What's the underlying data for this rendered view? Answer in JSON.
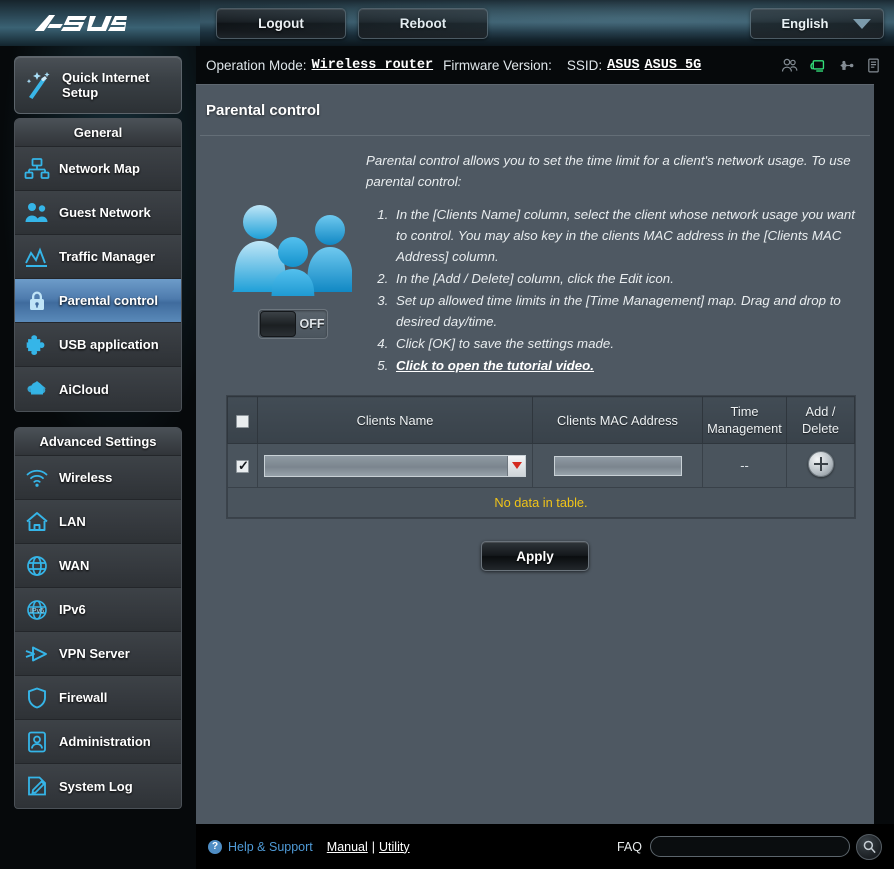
{
  "brand": {
    "logo_text": "/ISUS"
  },
  "topbar": {
    "logout_label": "Logout",
    "reboot_label": "Reboot",
    "language": "English"
  },
  "infobar": {
    "operation_mode_label": "Operation Mode:",
    "operation_mode_value": "Wireless router",
    "firmware_label": "Firmware Version:",
    "firmware_value": "",
    "ssid_label": "SSID:",
    "ssid_value_1": "ASUS",
    "ssid_value_2": "ASUS_5G",
    "icons": [
      "clients-icon",
      "network-status-icon",
      "usb-icon",
      "printer-icon"
    ]
  },
  "sidebar": {
    "quick_setup": "Quick Internet Setup",
    "general_header": "General",
    "general_items": [
      {
        "label": "Network Map",
        "icon": "network-map-icon",
        "active": false
      },
      {
        "label": "Guest Network",
        "icon": "guest-network-icon",
        "active": false
      },
      {
        "label": "Traffic Manager",
        "icon": "traffic-manager-icon",
        "active": false
      },
      {
        "label": "Parental control",
        "icon": "lock-icon",
        "active": true
      },
      {
        "label": "USB application",
        "icon": "puzzle-icon",
        "active": false
      },
      {
        "label": "AiCloud",
        "icon": "cloud-icon",
        "active": false
      }
    ],
    "advanced_header": "Advanced Settings",
    "advanced_items": [
      {
        "label": "Wireless",
        "icon": "wifi-icon"
      },
      {
        "label": "LAN",
        "icon": "home-icon"
      },
      {
        "label": "WAN",
        "icon": "globe-icon"
      },
      {
        "label": "IPv6",
        "icon": "ipv6-icon"
      },
      {
        "label": "VPN Server",
        "icon": "vpn-icon"
      },
      {
        "label": "Firewall",
        "icon": "shield-icon"
      },
      {
        "label": "Administration",
        "icon": "user-icon"
      },
      {
        "label": "System Log",
        "icon": "log-icon"
      }
    ]
  },
  "main": {
    "title": "Parental control",
    "intro": "Parental control allows you to set the time limit for a client's network usage. To use parental control:",
    "steps": [
      "In the [Clients Name] column, select the client whose network usage you want to control. You may also key in the clients MAC address in the [Clients MAC Address] column.",
      "In the [Add / Delete] column, click the Edit icon.",
      "Set up allowed time limits in the [Time Management] map. Drag and drop to desired day/time.",
      "Click [OK] to save the settings made."
    ],
    "step5_link": "Click to open the tutorial video.",
    "toggle_state": "OFF",
    "illustration": "family-icon"
  },
  "table": {
    "headers": [
      "",
      "Clients Name",
      "Clients MAC Address",
      "Time Management",
      "Add / Delete"
    ],
    "header_time_line1": "Time",
    "header_time_line2": "Management",
    "header_add_line1": "Add /",
    "header_add_line2": "Delete",
    "header_checkbox_checked": false,
    "row": {
      "checked": true,
      "client_name": "",
      "mac_address": "",
      "mac_placeholder": "",
      "time_management": "--",
      "add_icon": "plus-circle-icon"
    },
    "empty_message": "No data in table."
  },
  "actions": {
    "apply_label": "Apply"
  },
  "footer": {
    "help_support": "Help & Support",
    "manual": "Manual",
    "separator": "|",
    "utility": "Utility",
    "faq_label": "FAQ",
    "faq_value": "",
    "faq_placeholder": "",
    "search_icon": "magnifier-icon"
  },
  "colors": {
    "panel_bg": "#4e5862",
    "accent_blue": "#29a3dd",
    "active_nav": "#5a8ab9",
    "warning_text": "#f0c419",
    "link_blue": "#4f9ad6"
  }
}
